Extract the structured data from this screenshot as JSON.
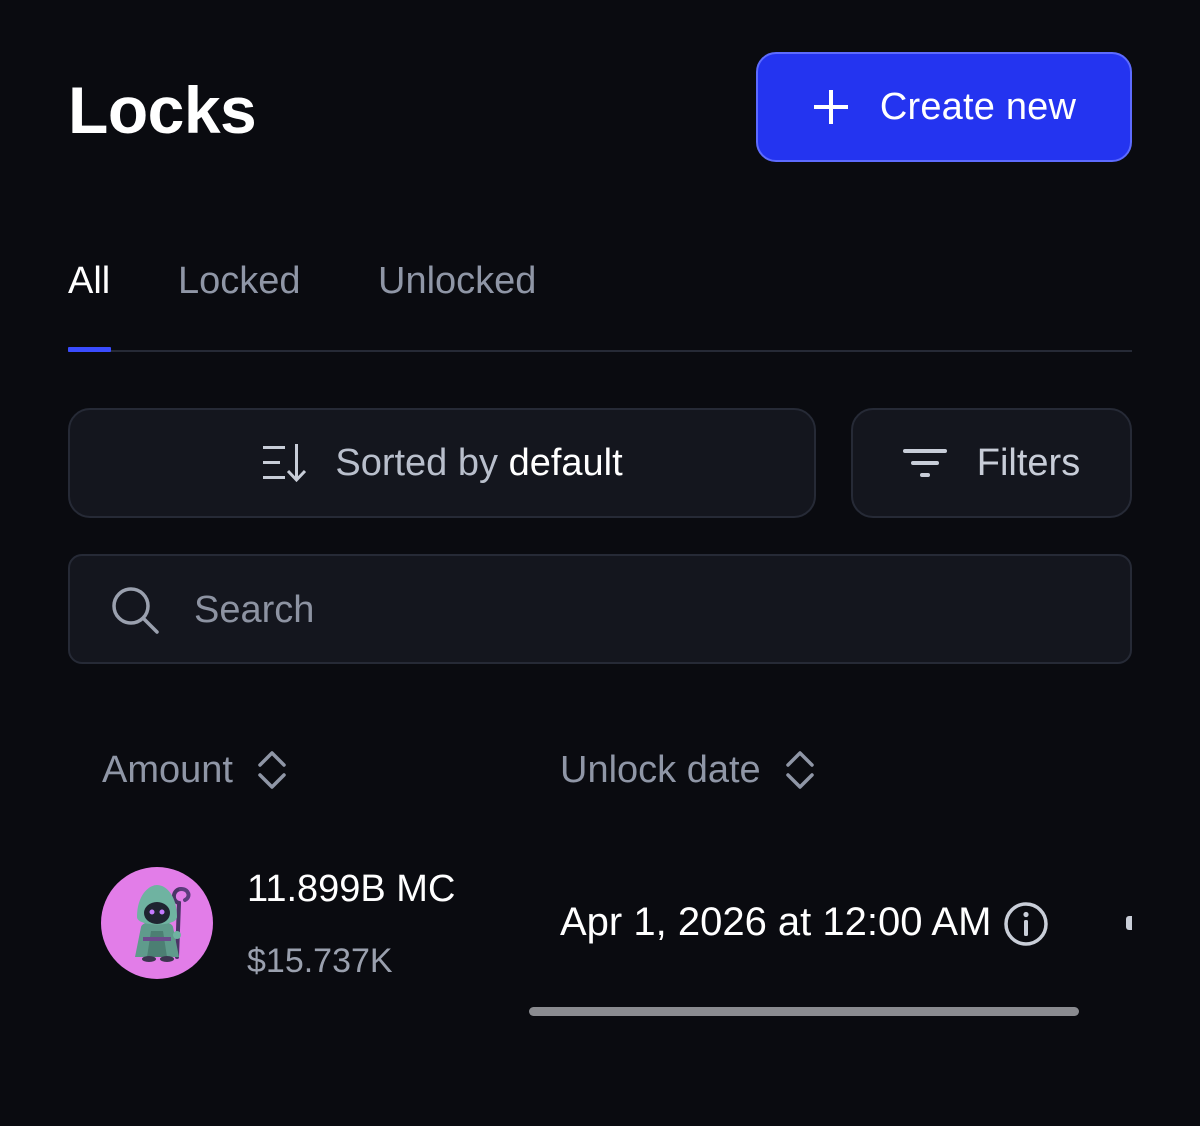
{
  "header": {
    "title": "Locks",
    "create_button": {
      "label": "Create new",
      "icon": "plus-icon"
    }
  },
  "tabs": [
    {
      "label": "All",
      "active": true
    },
    {
      "label": "Locked",
      "active": false
    },
    {
      "label": "Unlocked",
      "active": false
    }
  ],
  "controls": {
    "sort": {
      "prefix": "Sorted by",
      "value": "default",
      "icon": "sort-descending-icon"
    },
    "filters": {
      "label": "Filters",
      "icon": "filter-icon"
    }
  },
  "search": {
    "placeholder": "Search",
    "value": "",
    "icon": "search-icon"
  },
  "table": {
    "columns": [
      {
        "label": "Amount",
        "icon": "sort-toggle-icon"
      },
      {
        "label": "Unlock date",
        "icon": "sort-toggle-icon"
      }
    ],
    "rows": [
      {
        "avatar": "hooded-wizard-token-avatar",
        "amount": "11.899B MC",
        "value_usd": "$15.737K",
        "unlock_date": "Apr 1, 2026 at 12:00 AM",
        "info_icon": "info-icon"
      }
    ]
  },
  "colors": {
    "background": "#0a0b10",
    "accent": "#2434f0",
    "tab_indicator": "#3a4cff",
    "panel": "#14161e",
    "avatar_bg": "#e27de8"
  }
}
